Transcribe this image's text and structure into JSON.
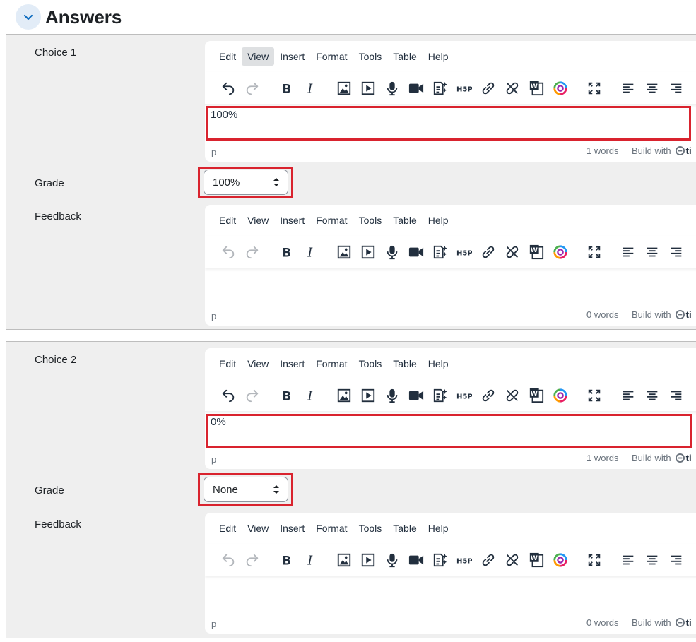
{
  "section": {
    "title": "Answers",
    "toggle_icon": "chevron-down-icon"
  },
  "editor_menu": [
    "Edit",
    "View",
    "Insert",
    "Format",
    "Tools",
    "Table",
    "Help"
  ],
  "status": {
    "path": "p",
    "brand": "Build with",
    "brand_suffix": "ti"
  },
  "choices": [
    {
      "choice_label": "Choice 1",
      "choice_content": "100%",
      "choice_words": "1 words",
      "grade_label": "Grade",
      "grade_value": "100%",
      "feedback_label": "Feedback",
      "feedback_content": "",
      "feedback_words": "0 words"
    },
    {
      "choice_label": "Choice 2",
      "choice_content": "0%",
      "choice_words": "1 words",
      "grade_label": "Grade",
      "grade_value": "None",
      "feedback_label": "Feedback",
      "feedback_content": "",
      "feedback_words": "0 words"
    }
  ],
  "colors": {
    "highlight": "#d9232e",
    "panel": "#efefef",
    "accent": "#0f6cbf"
  }
}
